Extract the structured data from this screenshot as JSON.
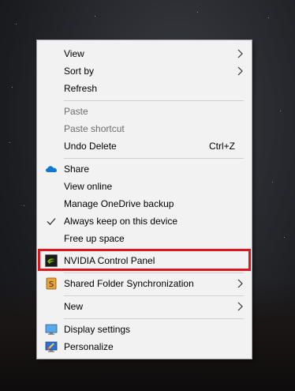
{
  "context_menu": {
    "items": [
      {
        "label": "View",
        "shortcut": "",
        "submenu": true,
        "enabled": true
      },
      {
        "label": "Sort by",
        "shortcut": "",
        "submenu": true,
        "enabled": true
      },
      {
        "label": "Refresh",
        "shortcut": "",
        "submenu": false,
        "enabled": true
      },
      {
        "label": "Paste",
        "shortcut": "",
        "submenu": false,
        "enabled": false
      },
      {
        "label": "Paste shortcut",
        "shortcut": "",
        "submenu": false,
        "enabled": false
      },
      {
        "label": "Undo Delete",
        "shortcut": "Ctrl+Z",
        "submenu": false,
        "enabled": true
      },
      {
        "label": "Share",
        "icon": "onedrive-cloud-icon",
        "submenu": false,
        "enabled": true
      },
      {
        "label": "View online",
        "submenu": false,
        "enabled": true
      },
      {
        "label": "Manage OneDrive backup",
        "submenu": false,
        "enabled": true
      },
      {
        "label": "Always keep on this device",
        "icon": "checkmark-icon",
        "checked": true,
        "submenu": false,
        "enabled": true
      },
      {
        "label": "Free up space",
        "submenu": false,
        "enabled": true
      },
      {
        "label": "NVIDIA Control Panel",
        "icon": "nvidia-icon",
        "submenu": false,
        "enabled": true,
        "highlighted": true
      },
      {
        "label": "Shared Folder Synchronization",
        "icon": "shared-folder-sync-icon",
        "submenu": true,
        "enabled": true
      },
      {
        "label": "New",
        "submenu": true,
        "enabled": true
      },
      {
        "label": "Display settings",
        "icon": "display-settings-icon",
        "submenu": false,
        "enabled": true
      },
      {
        "label": "Personalize",
        "icon": "personalize-icon",
        "submenu": false,
        "enabled": true
      }
    ]
  },
  "colors": {
    "menu_background": "#f2f2f2",
    "highlight_border": "#e0161e",
    "disabled_text": "#6d6d6d",
    "onedrive_blue": "#0f78d4",
    "nvidia_green": "#76b900"
  }
}
